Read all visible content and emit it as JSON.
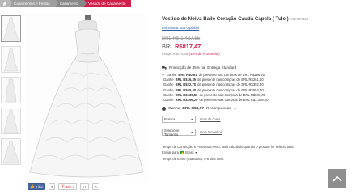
{
  "breadcrumb": {
    "home_icon": "home-icon",
    "items": [
      "Casamentos e Festas",
      "Casamento",
      "Vestido de Casamento"
    ]
  },
  "product": {
    "title": "Vestido de Noiva Baile Coração Cauda Capela ( Tule )",
    "sku": "#02720421",
    "ask_link": "Escreva a sua Opinião",
    "old_price": "BRL R$ 1.487,85",
    "currency": "BRL",
    "price": "R$817,47",
    "save_prefix": "Poupe R$670,38",
    "save_percent": "(45% de Promoção)"
  },
  "promo": {
    "text": "Promoção de 45% na",
    "link": "Entrega Standard"
  },
  "tiers": [
    {
      "label": "Ganhe",
      "amount": "BRL R$0,81",
      "rest": "de presente nas compras de BRL R$196,20"
    },
    {
      "label": "Ganhe",
      "amount": "BRL R$16,35",
      "rest": "de presente nas compras de BRL R$261,60"
    },
    {
      "label": "Ganhe",
      "amount": "BRL R$22,70",
      "rest": "de presente nas compras de BRL R$392,40"
    },
    {
      "label": "Ganhe",
      "amount": "BRL R$65,40",
      "rest": "de presente nas compras de BRL R$654,00"
    },
    {
      "label": "Ganhe",
      "amount": "BRL R$130,80",
      "rest": "de presente nas compras de BRL R$981,00"
    },
    {
      "label": "Ganhe",
      "amount": "BRL R$196,20",
      "rest": "de presente nas compras de BRL R$1.308,00"
    }
  ],
  "rewards": {
    "prefix": "Ganha",
    "amount": "BRL R$8,17",
    "suffix": "Recompensas"
  },
  "color_select": {
    "value": "Branca",
    "guide": "Guia de cores"
  },
  "size_select": {
    "value": "Selecione Tamanho",
    "guide": "Guia tamanhos"
  },
  "shipping": {
    "line1": "Tempo de Confecção e Processamento: será calculado quando o produto for selecionada.",
    "ship_to_label": "Enviar para",
    "ship_to_value": "Brasil",
    "line3": "Tempo de Envio (Standard): 5-8 dias úteis"
  },
  "social": {
    "like": "Like",
    "like_count": "2",
    "pin": "Pin it",
    "plus": "+1",
    "plus_count": "0"
  },
  "colors": {
    "accent": "#d11f4c",
    "link": "#2c5fa8"
  }
}
